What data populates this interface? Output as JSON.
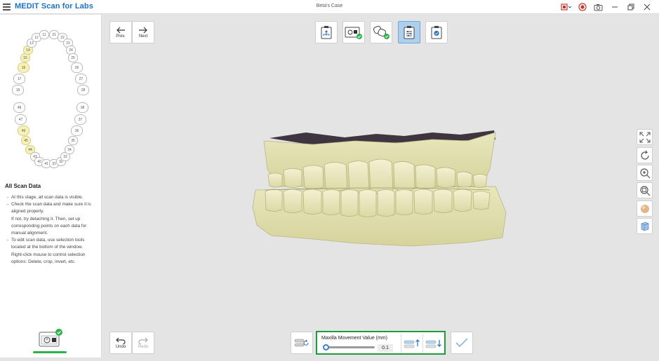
{
  "titlebar": {
    "app_title": "MEDIT Scan for Labs",
    "case_title": "Beta's Case"
  },
  "nav": {
    "prev_label": "Prev.",
    "next_label": "Next"
  },
  "teeth": {
    "upper_right": [
      "18",
      "17",
      "16",
      "15",
      "14",
      "13",
      "12",
      "11"
    ],
    "upper_left": [
      "21",
      "22",
      "23",
      "24",
      "25",
      "26",
      "27",
      "28"
    ],
    "lower_right": [
      "48",
      "47",
      "46",
      "45",
      "44",
      "43",
      "42",
      "41"
    ],
    "lower_left": [
      "31",
      "32",
      "33",
      "34",
      "35",
      "36",
      "37",
      "38"
    ],
    "selected": [
      "14",
      "15",
      "16",
      "44",
      "45",
      "46"
    ]
  },
  "info": {
    "title": "All Scan Data",
    "items": [
      "At this stage, all scan data is visible.",
      "Check the scan data and make sure it is aligned properly.\nIf not, try detaching it. Then, set up corresponding points on each data for manual alignment.",
      "To edit scan data, use selection tools located at the bottom of the window.\nRight-click mouse to control selection options: Delete, crop, invert, etc."
    ]
  },
  "bottom": {
    "undo_label": "Undo",
    "redo_label": "Redo",
    "movement_label": "Maxilla Movement Value (mm)",
    "movement_value": "0.1",
    "movement_fraction": 0.03
  },
  "colors": {
    "accent": "#1a73c8",
    "highlight_green": "#1e9b3a",
    "tooth_selected": "#f6f1b6",
    "model": "#e8e6b6"
  }
}
